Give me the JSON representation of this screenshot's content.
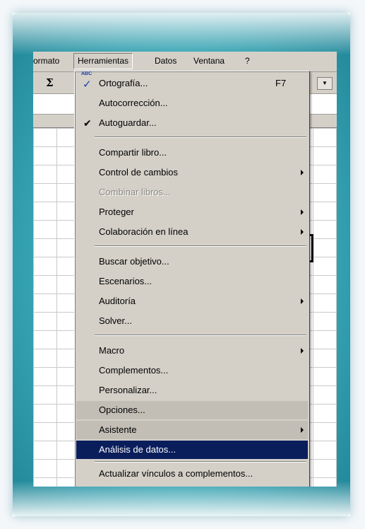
{
  "menubar": {
    "items": [
      {
        "label": "ormato"
      },
      {
        "label": "Herramientas"
      },
      {
        "label": "Datos"
      },
      {
        "label": "Ventana"
      },
      {
        "label": "?"
      }
    ]
  },
  "toolbar": {
    "sigma_glyph": "Σ"
  },
  "menu": {
    "items": [
      {
        "label": "Ortografía...",
        "shortcut": "F7",
        "icon": "spelling-icon"
      },
      {
        "label": "Autocorrección..."
      },
      {
        "label": "Autoguardar...",
        "icon": "checkmark-icon"
      },
      {
        "label": "Compartir libro..."
      },
      {
        "label": "Control de cambios",
        "submenu": true
      },
      {
        "label": "Combinar libros...",
        "disabled": true
      },
      {
        "label": "Proteger",
        "submenu": true
      },
      {
        "label": "Colaboración en línea",
        "submenu": true
      },
      {
        "label": "Buscar objetivo..."
      },
      {
        "label": "Escenarios..."
      },
      {
        "label": "Auditoría",
        "submenu": true
      },
      {
        "label": "Solver..."
      },
      {
        "label": "Macro",
        "submenu": true
      },
      {
        "label": "Complementos..."
      },
      {
        "label": "Personalizar..."
      },
      {
        "label": "Opciones..."
      },
      {
        "label": "Asistente",
        "submenu": true
      },
      {
        "label": "Análisis de datos...",
        "highlighted": true
      },
      {
        "label": "Actualizar vínculos a complementos..."
      }
    ]
  },
  "colors": {
    "frame": "#3aa9b8",
    "menu_bg": "#d4d0c8",
    "highlight": "#0a1e5c"
  }
}
